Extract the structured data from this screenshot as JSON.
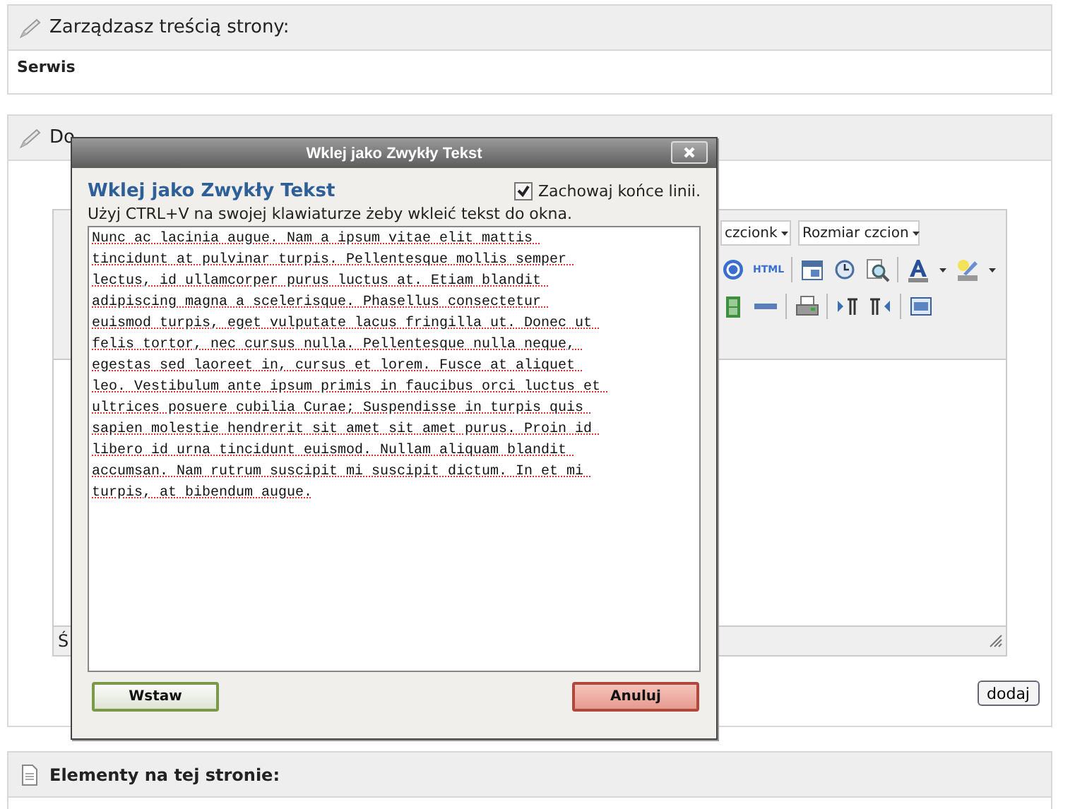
{
  "site_panel": {
    "title": "Zarządzasz treścią strony:",
    "value": "Serwis"
  },
  "editor_panel": {
    "title": "Do",
    "font_select": "czcionk",
    "size_select": "Rozmiar czcion",
    "html_label": "HTML",
    "status": "Ś",
    "submit": "dodaj"
  },
  "elements_panel": {
    "title": "Elementy na tej stronie:"
  },
  "dialog": {
    "title": "Wklej jako Zwykły Tekst",
    "heading": "Wklej jako Zwykły Tekst",
    "keep_line_breaks": {
      "label": "Zachowaj końce linii.",
      "checked": true
    },
    "hint": "Użyj CTRL+V na swojej klawiaturze żeby wkleić tekst do okna.",
    "text": "Nunc ac lacinia augue. Nam a ipsum vitae elit mattis tincidunt at pulvinar turpis. Pellentesque mollis semper lectus, id ullamcorper purus luctus at. Etiam blandit adipiscing magna a scelerisque. Phasellus consectetur euismod turpis, eget vulputate lacus fringilla ut. Donec ut felis tortor, nec cursus nulla. Pellentesque nulla neque, egestas sed laoreet in, cursus et lorem. Fusce at aliquet leo. Vestibulum ante ipsum primis in faucibus orci luctus et ultrices posuere cubilia Curae; Suspendisse in turpis quis sapien molestie hendrerit sit amet sit amet purus. Proin id libero id urna tincidunt euismod. Nullam aliquam blandit accumsan. Nam rutrum suscipit mi suscipit dictum. In et mi turpis, at bibendum augue.",
    "buttons": [
      {
        "label": "Wstaw",
        "kind": "confirm"
      },
      {
        "label": "Anuluj",
        "kind": "cancel"
      }
    ]
  }
}
